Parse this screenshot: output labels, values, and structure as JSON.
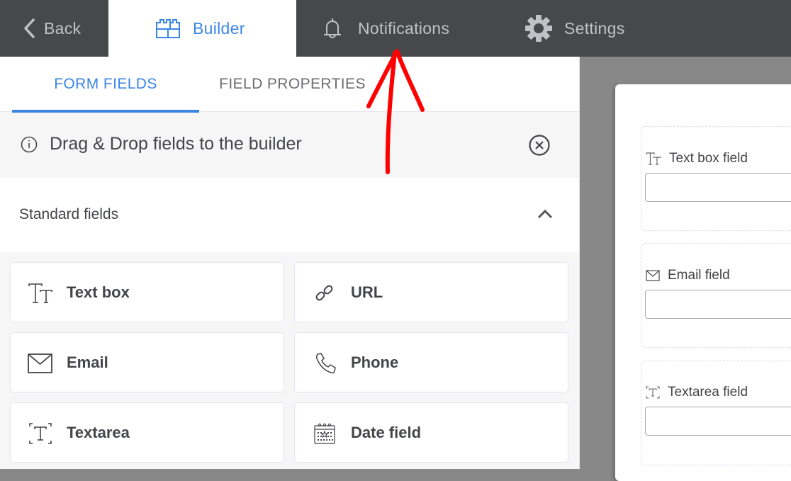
{
  "topbar": {
    "back_label": "Back",
    "builder_label": "Builder",
    "notifications_label": "Notifications",
    "settings_label": "Settings",
    "active_tab": "Builder",
    "accent_color": "#3a86e6"
  },
  "panel_tabs": {
    "form_fields": "FORM FIELDS",
    "field_properties": "FIELD PROPERTIES",
    "active": "FORM FIELDS"
  },
  "info_banner": {
    "text": "Drag & Drop fields to the builder",
    "icon": "info-icon",
    "close_icon": "close-circle-icon"
  },
  "section": {
    "title": "Standard fields",
    "expanded": true,
    "fields": [
      {
        "label": "Text box",
        "icon": "text-size-icon"
      },
      {
        "label": "URL",
        "icon": "link-icon"
      },
      {
        "label": "Email",
        "icon": "envelope-icon"
      },
      {
        "label": "Phone",
        "icon": "phone-icon"
      },
      {
        "label": "Textarea",
        "icon": "textarea-icon"
      },
      {
        "label": "Date field",
        "icon": "calendar-icon"
      }
    ]
  },
  "form_preview": {
    "fields": [
      {
        "label": "Text box field",
        "icon": "text-size-icon",
        "value": ""
      },
      {
        "label": "Email field",
        "icon": "envelope-icon",
        "value": ""
      },
      {
        "label": "Textarea field",
        "icon": "textarea-icon",
        "value": ""
      }
    ]
  },
  "annotation": {
    "type": "red-arrow",
    "points_to": "Notifications",
    "color": "#ff0000"
  }
}
